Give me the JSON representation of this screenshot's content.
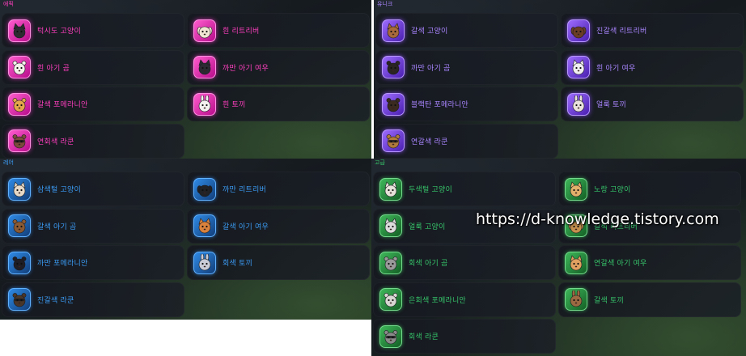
{
  "panels": {
    "epic": {
      "title": "에픽",
      "items": [
        {
          "label": "턱시도 고양이",
          "icon": "cat-icon",
          "animal": "cat",
          "tint": "#2b2b30"
        },
        {
          "label": "흰 리트리버",
          "icon": "dog-icon",
          "animal": "dog",
          "tint": "#f1e6d4"
        },
        {
          "label": "흰 아기 곰",
          "icon": "bear-icon",
          "animal": "bear",
          "tint": "#f3f0ea"
        },
        {
          "label": "까만 아기 여우",
          "icon": "fox-icon",
          "animal": "fox",
          "tint": "#2a2a33"
        },
        {
          "label": "갈색 포메라니안",
          "icon": "pomeranian-icon",
          "animal": "pom",
          "tint": "#e4a64a"
        },
        {
          "label": "흰 토끼",
          "icon": "rabbit-icon",
          "animal": "rabbit",
          "tint": "#f4f0f0"
        },
        {
          "label": "연회색 라쿤",
          "icon": "raccoon-icon",
          "animal": "raccoon",
          "tint": "#7a4a3a"
        }
      ]
    },
    "unique": {
      "title": "유니크",
      "items": [
        {
          "label": "갈색 고양이",
          "icon": "cat-icon",
          "animal": "cat",
          "tint": "#a86a3a"
        },
        {
          "label": "진갈색 리트리버",
          "icon": "dog-icon",
          "animal": "dog",
          "tint": "#6a3e26"
        },
        {
          "label": "까만 아기 곰",
          "icon": "bear-icon",
          "animal": "bear",
          "tint": "#2a2522"
        },
        {
          "label": "흰 아기 여우",
          "icon": "fox-icon",
          "animal": "fox",
          "tint": "#f1eef2"
        },
        {
          "label": "블랙탄 포메라니안",
          "icon": "pomeranian-icon",
          "animal": "pom",
          "tint": "#3a2a20"
        },
        {
          "label": "얼룩 토끼",
          "icon": "rabbit-icon",
          "animal": "rabbit",
          "tint": "#e9e2dc"
        },
        {
          "label": "연갈색 라쿤",
          "icon": "raccoon-icon",
          "animal": "raccoon",
          "tint": "#b07a3c"
        }
      ]
    },
    "rare": {
      "title": "레어",
      "items": [
        {
          "label": "삼색털 고양이",
          "icon": "cat-icon",
          "animal": "cat",
          "tint": "#e8d9c6"
        },
        {
          "label": "까만 리트리버",
          "icon": "dog-icon",
          "animal": "dog",
          "tint": "#202226"
        },
        {
          "label": "갈색 아기 곰",
          "icon": "bear-icon",
          "animal": "bear",
          "tint": "#8a5a34"
        },
        {
          "label": "갈색 아기 여우",
          "icon": "fox-icon",
          "animal": "fox",
          "tint": "#d9823e"
        },
        {
          "label": "까만 포메라니안",
          "icon": "pomeranian-icon",
          "animal": "pom",
          "tint": "#1e1e24"
        },
        {
          "label": "회색 토끼",
          "icon": "rabbit-icon",
          "animal": "rabbit",
          "tint": "#c9ccd6"
        },
        {
          "label": "진갈색 라쿤",
          "icon": "raccoon-icon",
          "animal": "raccoon",
          "tint": "#4a3628"
        }
      ]
    },
    "legendary": {
      "title": "고급",
      "items": [
        {
          "label": "두색털 고양이",
          "icon": "cat-icon",
          "animal": "cat",
          "tint": "#e6e2da"
        },
        {
          "label": "노랑 고양이",
          "icon": "cat-icon",
          "animal": "cat",
          "tint": "#e2b06a"
        },
        {
          "label": "얼룩 고양이",
          "icon": "cat-icon",
          "animal": "cat",
          "tint": "#dcdcdc"
        },
        {
          "label": "갈색 리트리버",
          "icon": "dog-icon",
          "animal": "dog",
          "tint": "#c4904e"
        },
        {
          "label": "회색 아기 곰",
          "icon": "bear-icon",
          "animal": "bear",
          "tint": "#9a9a9a"
        },
        {
          "label": "연갈색 아기 여우",
          "icon": "fox-icon",
          "animal": "fox",
          "tint": "#e0a060"
        },
        {
          "label": "은회색 포메라니안",
          "icon": "pomeranian-icon",
          "animal": "pom",
          "tint": "#d8d6d2"
        },
        {
          "label": "갈색 토끼",
          "icon": "rabbit-icon",
          "animal": "rabbit",
          "tint": "#9b6a42"
        },
        {
          "label": "회색 라쿤",
          "icon": "raccoon-icon",
          "animal": "raccoon",
          "tint": "#8a8a8a"
        }
      ]
    }
  },
  "watermark": "https://d-knowledge.tistory.com"
}
